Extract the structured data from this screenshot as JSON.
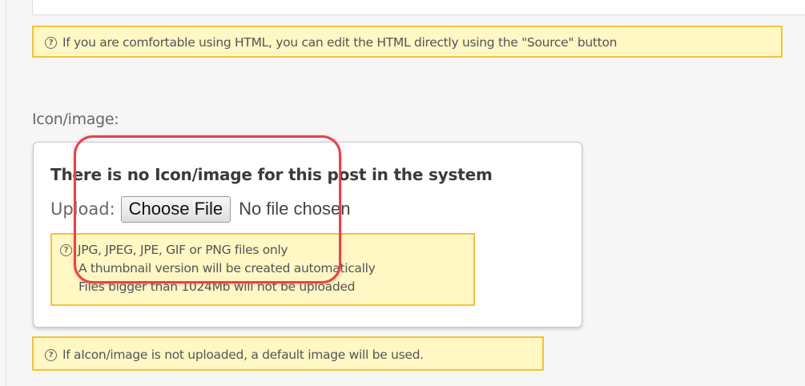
{
  "source_help": {
    "icon": "help-circle-icon",
    "text": "If you are comfortable using HTML, you can edit the HTML directly using the \"Source\" button"
  },
  "icon_field": {
    "label": "Icon/image:",
    "card_title": "There is no Icon/image for this post in the system",
    "upload_label": "Upload:",
    "choose_file_label": "Choose File",
    "file_status": "No file chosen",
    "file_help": {
      "icon": "help-circle-icon",
      "line1": "JPG, JPEG, JPE, GIF or PNG files only",
      "line2": "A thumbnail version will be created automatically",
      "line3": "Files bigger than 1024Mb will not be uploaded"
    },
    "default_help": {
      "icon": "help-circle-icon",
      "text": "If aIcon/image is not uploaded, a default image will be used."
    }
  },
  "colors": {
    "help_background": "#fff7c4",
    "help_border": "#f5c23a",
    "highlight": "#e5434b"
  }
}
